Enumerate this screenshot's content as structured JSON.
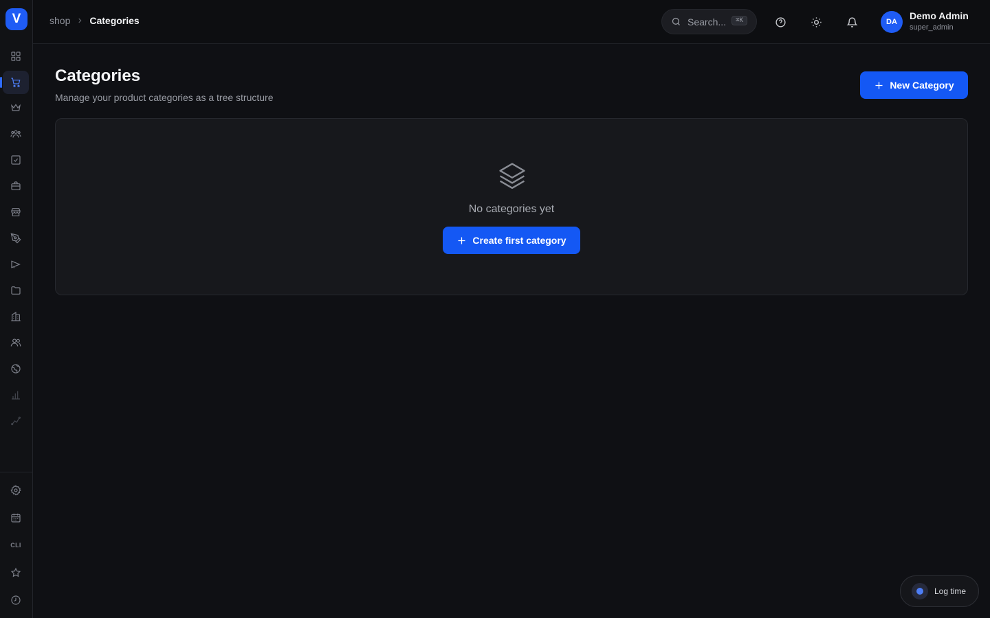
{
  "app": {
    "logo_letter": "V",
    "accent_color": "#1458f4"
  },
  "breadcrumb": {
    "parent": "shop",
    "current": "Categories"
  },
  "search": {
    "placeholder": "Search...",
    "shortcut": "⌘K"
  },
  "user": {
    "initials": "DA",
    "name": "Demo Admin",
    "role": "super_admin"
  },
  "page": {
    "title": "Categories",
    "subtitle": "Manage your product categories as a tree structure",
    "new_button": "New Category"
  },
  "empty_state": {
    "message": "No categories yet",
    "action": "Create first category",
    "icon": "layers-icon"
  },
  "sidebar": {
    "items": [
      {
        "icon": "dashboard-icon"
      },
      {
        "icon": "shopping-cart-icon",
        "active": true
      },
      {
        "icon": "crown-icon"
      },
      {
        "icon": "users-icon"
      },
      {
        "icon": "checkbox-icon"
      },
      {
        "icon": "briefcase-icon"
      },
      {
        "icon": "store-icon"
      },
      {
        "icon": "pen-tool-icon"
      },
      {
        "icon": "megaphone-icon"
      },
      {
        "icon": "folder-icon"
      },
      {
        "icon": "building-icon"
      },
      {
        "icon": "team-icon"
      },
      {
        "icon": "globe-icon"
      },
      {
        "icon": "bar-chart-icon"
      },
      {
        "icon": "trend-icon"
      }
    ],
    "bottom": [
      {
        "icon": "settings-icon"
      },
      {
        "icon": "calendar-icon"
      },
      {
        "label": "CLI"
      },
      {
        "icon": "star-icon"
      },
      {
        "icon": "clock-icon"
      }
    ]
  },
  "log_time": {
    "label": "Log time"
  }
}
